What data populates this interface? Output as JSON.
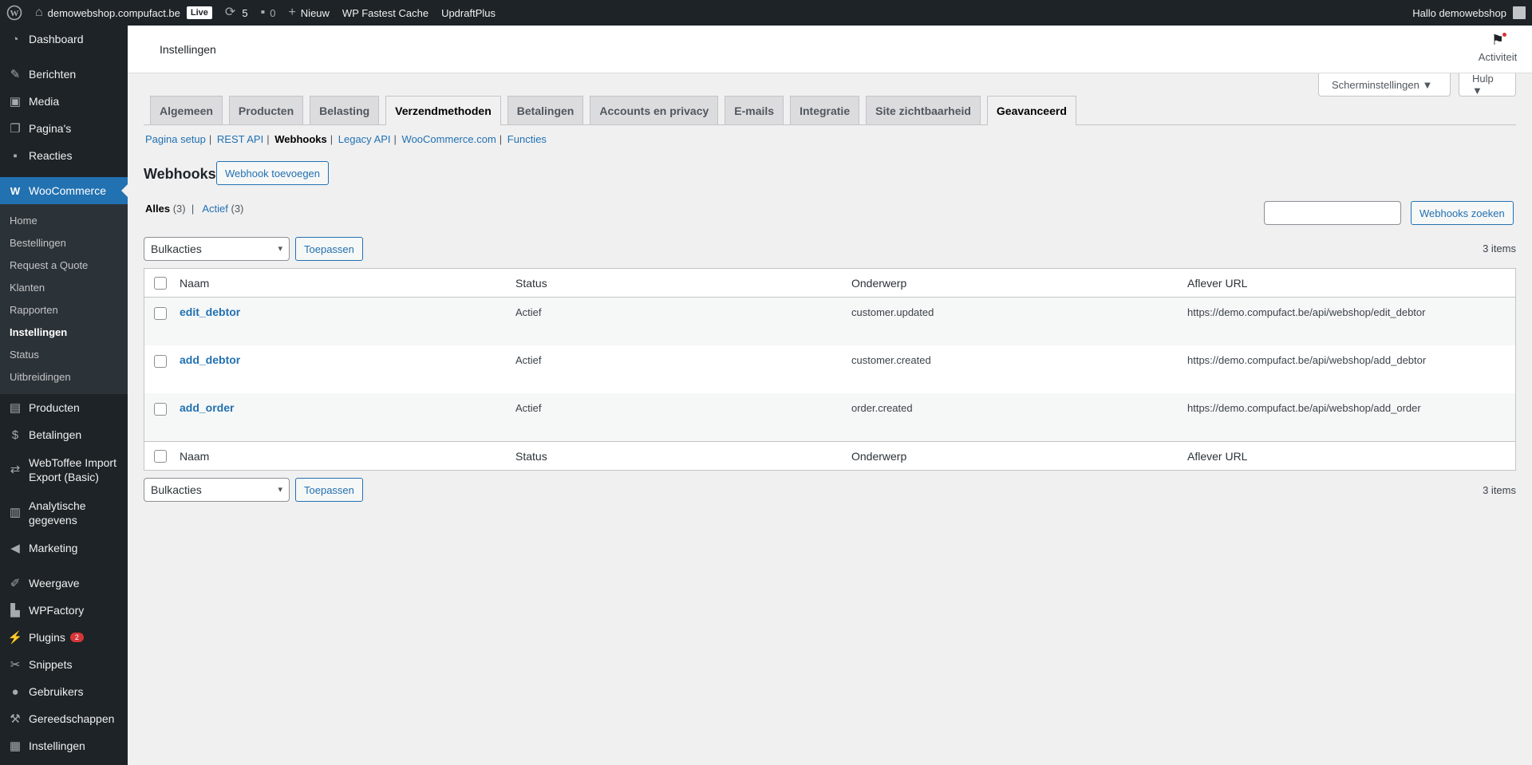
{
  "adminbar": {
    "site_name": "demowebshop.compufact.be",
    "live_label": "Live",
    "updates_count": "5",
    "comments_count": "0",
    "new_label": "Nieuw",
    "fastest_cache": "WP Fastest Cache",
    "updraft": "UpdraftPlus",
    "greeting": "Hallo demowebshop"
  },
  "sidebar": {
    "top_items": [
      {
        "label": "Dashboard",
        "icon": "dashboard-icon"
      },
      {
        "label": "Berichten",
        "icon": "pin-icon"
      },
      {
        "label": "Media",
        "icon": "media-icon"
      },
      {
        "label": "Pagina's",
        "icon": "pages-icon"
      },
      {
        "label": "Reacties",
        "icon": "comments-icon"
      }
    ],
    "woocommerce": {
      "label": "WooCommerce",
      "icon": "woo-icon"
    },
    "submenu": [
      {
        "label": "Home"
      },
      {
        "label": "Bestellingen"
      },
      {
        "label": "Request a Quote"
      },
      {
        "label": "Klanten"
      },
      {
        "label": "Rapporten"
      },
      {
        "label": "Instellingen",
        "current": true
      },
      {
        "label": "Status"
      },
      {
        "label": "Uitbreidingen"
      }
    ],
    "bottom_items": [
      {
        "label": "Producten",
        "icon": "archive-icon"
      },
      {
        "label": "Betalingen",
        "icon": "dollar-icon"
      },
      {
        "label": "WebToffee Import Export (Basic)",
        "icon": "import-export-icon"
      },
      {
        "label": "Analytische gegevens",
        "icon": "chart-icon"
      },
      {
        "label": "Marketing",
        "icon": "megaphone-icon"
      },
      {
        "label": "Weergave",
        "icon": "brush-icon"
      },
      {
        "label": "WPFactory",
        "icon": "factory-icon"
      },
      {
        "label": "Plugins",
        "icon": "plugin-icon",
        "badge": "2"
      },
      {
        "label": "Snippets",
        "icon": "snippets-icon"
      },
      {
        "label": "Gebruikers",
        "icon": "user-icon"
      },
      {
        "label": "Gereedschappen",
        "icon": "wrench-icon"
      },
      {
        "label": "Instellingen",
        "icon": "settings-icon"
      }
    ]
  },
  "header": {
    "title": "Instellingen",
    "activity_label": "Activiteit"
  },
  "screen_options": {
    "screen_settings": "Scherminstellingen ▼",
    "help": "Hulp ▼"
  },
  "tabs": [
    {
      "label": "Algemeen"
    },
    {
      "label": "Producten"
    },
    {
      "label": "Belasting"
    },
    {
      "label": "Verzendmethoden",
      "active": true
    },
    {
      "label": "Betalingen"
    },
    {
      "label": "Accounts en privacy"
    },
    {
      "label": "E-mails"
    },
    {
      "label": "Integratie"
    },
    {
      "label": "Site zichtbaarheid"
    },
    {
      "label": "Geavanceerd",
      "active": true
    }
  ],
  "sections": {
    "pagina_setup": "Pagina setup",
    "rest_api": "REST API",
    "webhooks": "Webhooks",
    "legacy_api": "Legacy API",
    "woocommerce_com": "WooCommerce.com",
    "functies": "Functies"
  },
  "page": {
    "heading": "Webhooks",
    "add_button": "Webhook toevoegen",
    "filter_all": "Alles",
    "filter_all_count": "(3)",
    "filter_active": "Actief",
    "filter_active_count": "(3)",
    "search_placeholder": "",
    "search_button": "Webhooks zoeken",
    "bulk_select": "Bulkacties",
    "apply_button": "Toepassen",
    "items_count": "3 items"
  },
  "table": {
    "columns": [
      "Naam",
      "Status",
      "Onderwerp",
      "Aflever URL"
    ],
    "rows": [
      {
        "name": "edit_debtor",
        "status": "Actief",
        "topic": "customer.updated",
        "url": "https://demo.compufact.be/api/webshop/edit_debtor"
      },
      {
        "name": "add_debtor",
        "status": "Actief",
        "topic": "customer.created",
        "url": "https://demo.compufact.be/api/webshop/add_debtor"
      },
      {
        "name": "add_order",
        "status": "Actief",
        "topic": "order.created",
        "url": "https://demo.compufact.be/api/webshop/add_order"
      }
    ]
  },
  "colors": {
    "admin_dark": "#1d2327",
    "accent": "#2271b1",
    "badge_red": "#d63638"
  }
}
